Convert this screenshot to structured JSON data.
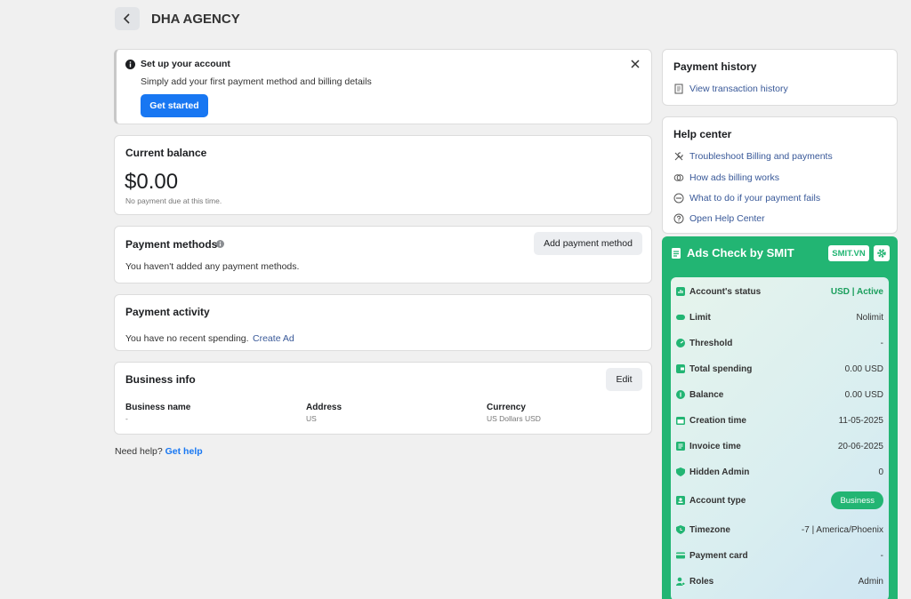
{
  "header": {
    "title": "DHA AGENCY"
  },
  "setup": {
    "title": "Set up your account",
    "desc": "Simply add your first payment method and billing details",
    "button": "Get started"
  },
  "balance": {
    "title": "Current balance",
    "amount": "$0.00",
    "note": "No payment due at this time."
  },
  "payment_methods": {
    "title": "Payment methods",
    "button": "Add payment method",
    "empty": "You haven't added any payment methods."
  },
  "activity": {
    "title": "Payment activity",
    "empty": "You have no recent spending.",
    "link": "Create Ad"
  },
  "business": {
    "title": "Business info",
    "edit": "Edit",
    "cols": [
      {
        "label": "Business name",
        "value": "-"
      },
      {
        "label": "Address",
        "value": "US"
      },
      {
        "label": "Currency",
        "value": "US Dollars USD"
      }
    ]
  },
  "help_footer": {
    "text": "Need help?",
    "link": "Get help"
  },
  "payment_history": {
    "title": "Payment history",
    "link": "View transaction history"
  },
  "help_center": {
    "title": "Help center",
    "items": [
      {
        "label": "Troubleshoot Billing and payments",
        "icon": "wrench-icon"
      },
      {
        "label": "How ads billing works",
        "icon": "coins-icon"
      },
      {
        "label": "What to do if your payment fails",
        "icon": "minus-circle-icon"
      },
      {
        "label": "Open Help Center",
        "icon": "question-circle-icon"
      }
    ]
  },
  "smit": {
    "title": "Ads Check by SMIT",
    "badge": "SMIT.VN",
    "rows": [
      {
        "label": "Account's status",
        "value": "USD | Active"
      },
      {
        "label": "Limit",
        "value": "Nolimit"
      },
      {
        "label": "Threshold",
        "value": "-"
      },
      {
        "label": "Total spending",
        "value": "0.00 USD"
      },
      {
        "label": "Balance",
        "value": "0.00 USD"
      },
      {
        "label": "Creation time",
        "value": "11-05-2025"
      },
      {
        "label": "Invoice time",
        "value": "20-06-2025"
      },
      {
        "label": "Hidden Admin",
        "value": "0"
      },
      {
        "label": "Account type",
        "value": "Business"
      },
      {
        "label": "Timezone",
        "value": "-7 | America/Phoenix"
      },
      {
        "label": "Payment card",
        "value": "-"
      },
      {
        "label": "Roles",
        "value": "Admin"
      }
    ],
    "colors": {
      "primary": "#22b573",
      "active": "#1a9e5c"
    }
  }
}
